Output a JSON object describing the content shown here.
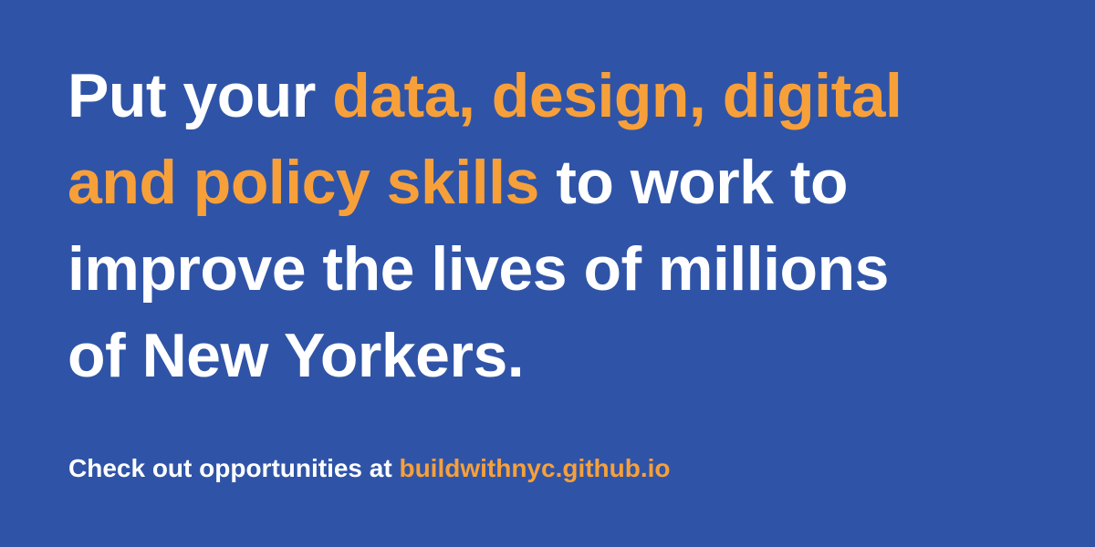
{
  "headline": {
    "line1": {
      "white": "Put your ",
      "accent": "data, design, digital"
    },
    "line2": {
      "accent": "and policy skills",
      "white": " to work to"
    },
    "line3": {
      "white": "improve the lives of millions"
    },
    "line4": {
      "white": "of New Yorkers."
    }
  },
  "cta": {
    "text": "Check out opportunities at ",
    "link": "buildwithnyc.github.io"
  },
  "colors": {
    "background": "#2f54a7",
    "text": "#ffffff",
    "accent": "#f7a03a"
  }
}
